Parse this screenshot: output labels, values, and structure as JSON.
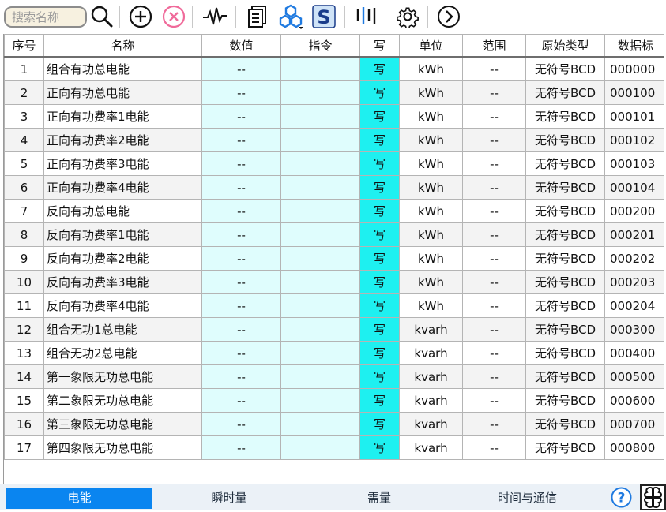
{
  "toolbar": {
    "search_placeholder": "搜索名称",
    "icons": [
      "search-icon",
      "add-circle-icon",
      "close-circle-icon",
      "waveform-icon",
      "document-icon",
      "hexagon-cluster-icon",
      "s-logo-icon",
      "bars-icon",
      "gear-icon",
      "arrow-right-circle-icon"
    ],
    "colors": {
      "close": "#f06a9a",
      "hex": "#1f7ae0",
      "s_bg": "#cfe3f7",
      "s_text": "#1a3c8a"
    }
  },
  "table": {
    "headers": [
      "序号",
      "名称",
      "数值",
      "指令",
      "写",
      "单位",
      "范围",
      "原始类型",
      "数据标"
    ],
    "rows": [
      {
        "no": "1",
        "name": "组合有功总电能",
        "value": "--",
        "cmd": "",
        "write": "写",
        "unit": "kWh",
        "range": "--",
        "type": "无符号BCD",
        "addr": "000000"
      },
      {
        "no": "2",
        "name": "正向有功总电能",
        "value": "--",
        "cmd": "",
        "write": "写",
        "unit": "kWh",
        "range": "--",
        "type": "无符号BCD",
        "addr": "000100"
      },
      {
        "no": "3",
        "name": "正向有功费率1电能",
        "value": "--",
        "cmd": "",
        "write": "写",
        "unit": "kWh",
        "range": "--",
        "type": "无符号BCD",
        "addr": "000101"
      },
      {
        "no": "4",
        "name": "正向有功费率2电能",
        "value": "--",
        "cmd": "",
        "write": "写",
        "unit": "kWh",
        "range": "--",
        "type": "无符号BCD",
        "addr": "000102"
      },
      {
        "no": "5",
        "name": "正向有功费率3电能",
        "value": "--",
        "cmd": "",
        "write": "写",
        "unit": "kWh",
        "range": "--",
        "type": "无符号BCD",
        "addr": "000103"
      },
      {
        "no": "6",
        "name": "正向有功费率4电能",
        "value": "--",
        "cmd": "",
        "write": "写",
        "unit": "kWh",
        "range": "--",
        "type": "无符号BCD",
        "addr": "000104"
      },
      {
        "no": "7",
        "name": "反向有功总电能",
        "value": "--",
        "cmd": "",
        "write": "写",
        "unit": "kWh",
        "range": "--",
        "type": "无符号BCD",
        "addr": "000200"
      },
      {
        "no": "8",
        "name": "反向有功费率1电能",
        "value": "--",
        "cmd": "",
        "write": "写",
        "unit": "kWh",
        "range": "--",
        "type": "无符号BCD",
        "addr": "000201"
      },
      {
        "no": "9",
        "name": "反向有功费率2电能",
        "value": "--",
        "cmd": "",
        "write": "写",
        "unit": "kWh",
        "range": "--",
        "type": "无符号BCD",
        "addr": "000202"
      },
      {
        "no": "10",
        "name": "反向有功费率3电能",
        "value": "--",
        "cmd": "",
        "write": "写",
        "unit": "kWh",
        "range": "--",
        "type": "无符号BCD",
        "addr": "000203"
      },
      {
        "no": "11",
        "name": "反向有功费率4电能",
        "value": "--",
        "cmd": "",
        "write": "写",
        "unit": "kWh",
        "range": "--",
        "type": "无符号BCD",
        "addr": "000204"
      },
      {
        "no": "12",
        "name": "组合无功1总电能",
        "value": "--",
        "cmd": "",
        "write": "写",
        "unit": "kvarh",
        "range": "--",
        "type": "无符号BCD",
        "addr": "000300"
      },
      {
        "no": "13",
        "name": "组合无功2总电能",
        "value": "--",
        "cmd": "",
        "write": "写",
        "unit": "kvarh",
        "range": "--",
        "type": "无符号BCD",
        "addr": "000400"
      },
      {
        "no": "14",
        "name": "第一象限无功总电能",
        "value": "--",
        "cmd": "",
        "write": "写",
        "unit": "kvarh",
        "range": "--",
        "type": "无符号BCD",
        "addr": "000500"
      },
      {
        "no": "15",
        "name": "第二象限无功总电能",
        "value": "--",
        "cmd": "",
        "write": "写",
        "unit": "kvarh",
        "range": "--",
        "type": "无符号BCD",
        "addr": "000600"
      },
      {
        "no": "16",
        "name": "第三象限无功总电能",
        "value": "--",
        "cmd": "",
        "write": "写",
        "unit": "kvarh",
        "range": "--",
        "type": "无符号BCD",
        "addr": "000700"
      },
      {
        "no": "17",
        "name": "第四象限无功总电能",
        "value": "--",
        "cmd": "",
        "write": "写",
        "unit": "kvarh",
        "range": "--",
        "type": "无符号BCD",
        "addr": "000800"
      }
    ]
  },
  "tabs": [
    {
      "label": "电能",
      "active": true
    },
    {
      "label": "瞬时量",
      "active": false
    },
    {
      "label": "需量",
      "active": false
    },
    {
      "label": "时间与通信",
      "active": false
    }
  ],
  "footer_icons": [
    "help-icon",
    "grid-cluster-icon"
  ]
}
